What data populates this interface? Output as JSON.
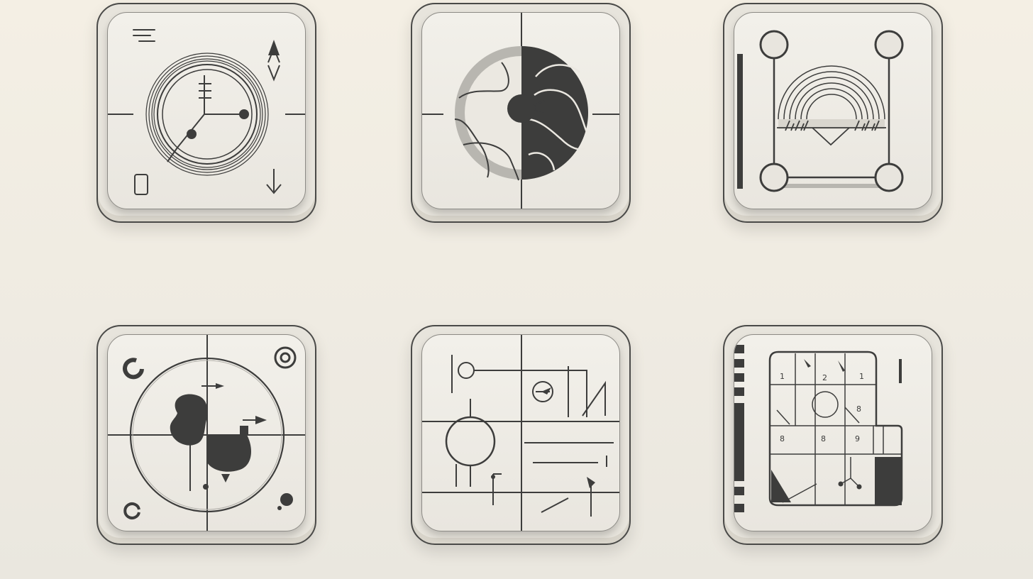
{
  "icons": [
    {
      "name": "clock-compass-icon"
    },
    {
      "name": "globe-map-icon"
    },
    {
      "name": "arch-frame-icon"
    },
    {
      "name": "crosshair-shape-icon"
    },
    {
      "name": "circuit-grid-icon"
    },
    {
      "name": "number-grid-icon"
    }
  ],
  "grid_labels": {
    "top_left": "1",
    "top_mid": "2",
    "top_right": "1",
    "mid_right": "8",
    "bottom_a": "8",
    "bottom_b": "8",
    "bottom_c": "9"
  },
  "colors": {
    "background": "#f2eee5",
    "tile": "#e7e4dc",
    "ink": "#3d3d3c"
  }
}
